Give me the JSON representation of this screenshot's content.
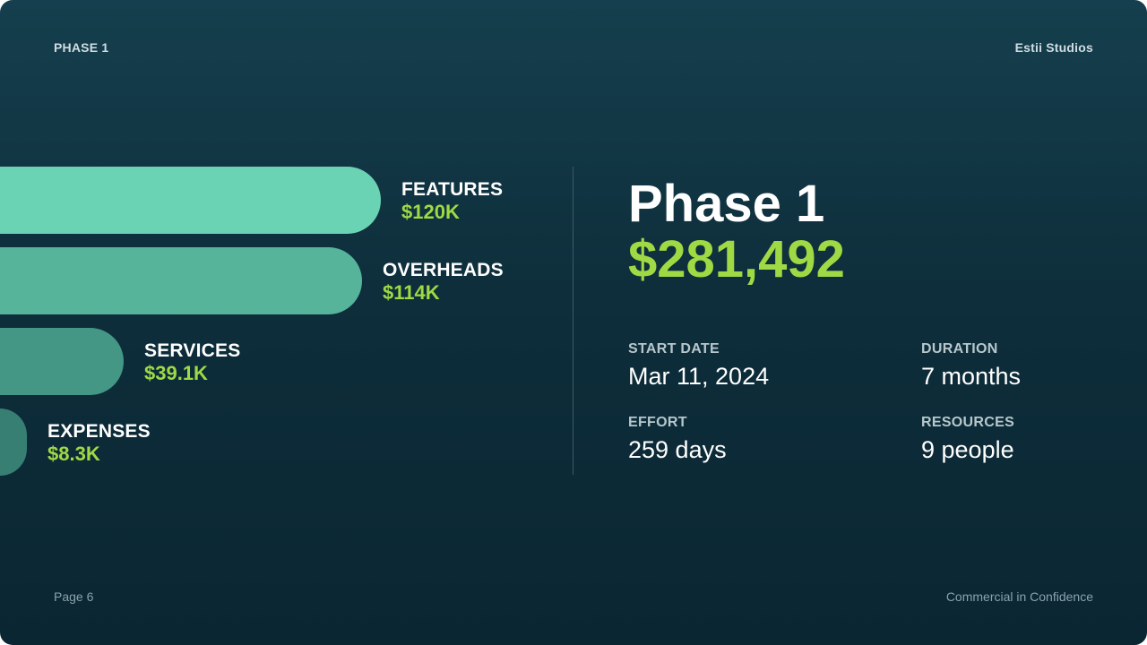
{
  "header": {
    "left": "PHASE 1",
    "right": "Estii Studios"
  },
  "footer": {
    "left": "Page 6",
    "right": "Commercial in Confidence"
  },
  "summary": {
    "title": "Phase 1",
    "total": "$281,492",
    "stats": [
      {
        "label": "START DATE",
        "value": "Mar 11, 2024"
      },
      {
        "label": "DURATION",
        "value": "7 months"
      },
      {
        "label": "EFFORT",
        "value": "259 days"
      },
      {
        "label": "RESOURCES",
        "value": "9 people"
      }
    ]
  },
  "colors": {
    "accent": "#9fd944",
    "bars": [
      "#6ad3b3",
      "#56b49b",
      "#439784",
      "#367f72"
    ]
  },
  "chart_data": {
    "type": "bar",
    "orientation": "horizontal",
    "categories": [
      "FEATURES",
      "OVERHEADS",
      "SERVICES",
      "EXPENSES"
    ],
    "values": [
      120000,
      114000,
      39100,
      8300
    ],
    "value_labels": [
      "$120K",
      "$114K",
      "$39.1K",
      "$8.3K"
    ],
    "title": "",
    "xlabel": "",
    "ylabel": "",
    "grid": false,
    "legend": "none"
  }
}
